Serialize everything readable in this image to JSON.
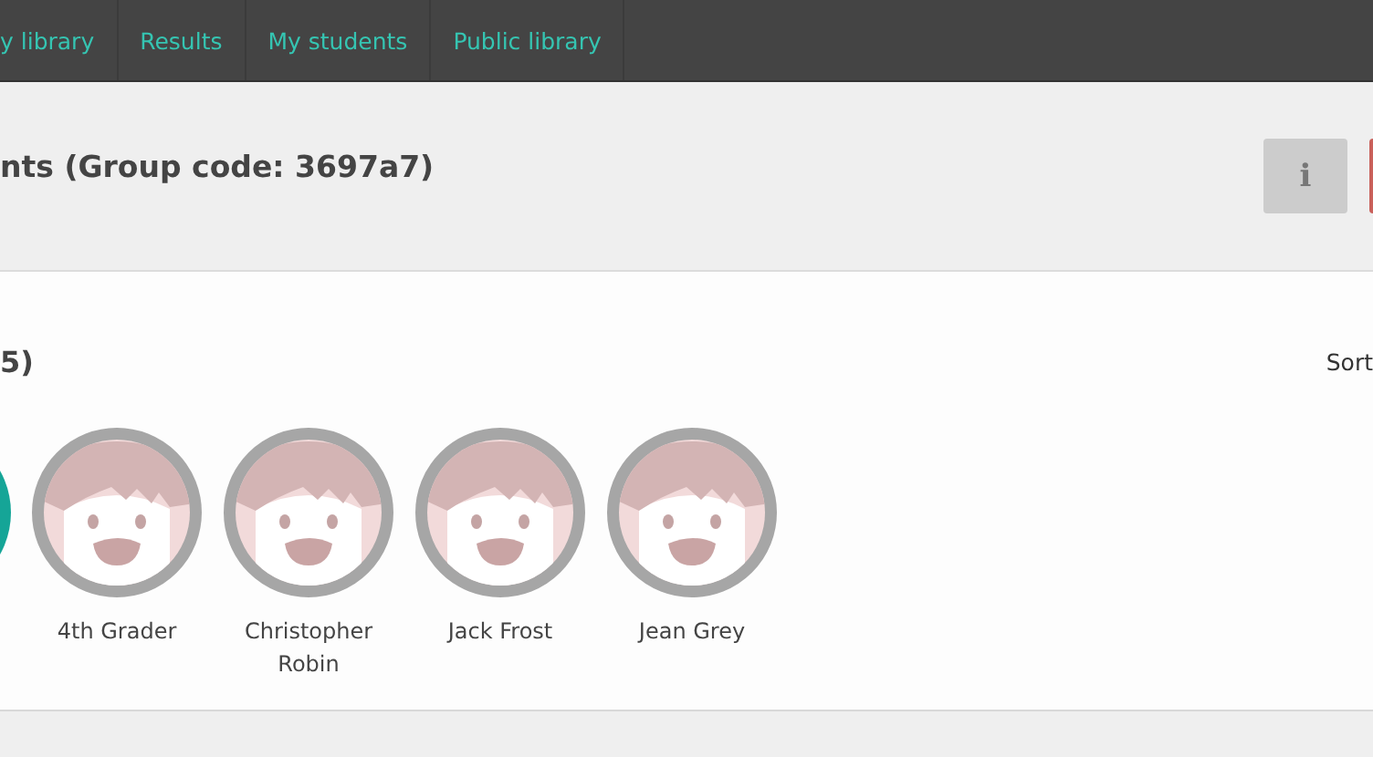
{
  "nav": {
    "items": [
      {
        "label": "y library",
        "selected": false
      },
      {
        "label": "Results",
        "selected": false
      },
      {
        "label": "My students",
        "selected": false
      },
      {
        "label": "Public library",
        "selected": false
      }
    ]
  },
  "header": {
    "title": "nts (Group code: 3697a7)",
    "info_button": "i"
  },
  "card": {
    "heading": "5)",
    "sort_label": "Sort",
    "students": [
      {
        "name": "4th Grader"
      },
      {
        "name": "Christopher Robin"
      },
      {
        "name": "Jack Frost"
      },
      {
        "name": "Jean Grey"
      }
    ]
  }
}
